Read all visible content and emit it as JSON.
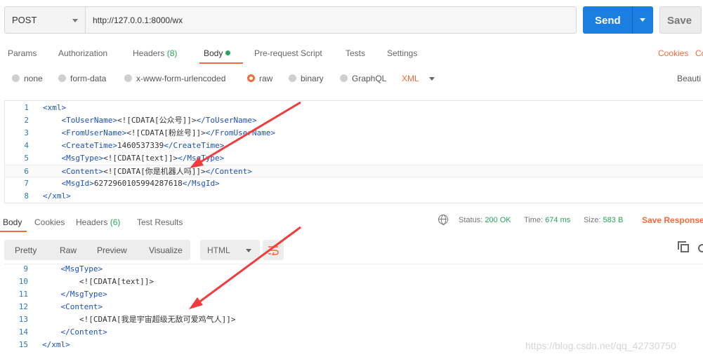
{
  "request": {
    "method": "POST",
    "url": "http://127.0.0.1:8000/wx",
    "send_label": "Send",
    "save_label": "Save"
  },
  "request_tabs": {
    "params": "Params",
    "authorization": "Authorization",
    "headers": "Headers",
    "headers_count": "(8)",
    "body": "Body",
    "prerequest": "Pre-request Script",
    "tests": "Tests",
    "settings": "Settings",
    "cookies": "Cookies",
    "code": "Co"
  },
  "body_types": {
    "none": "none",
    "form_data": "form-data",
    "urlencoded": "x-www-form-urlencoded",
    "raw": "raw",
    "binary": "binary",
    "graphql": "GraphQL",
    "format": "XML",
    "beautify": "Beauti"
  },
  "request_body": [
    {
      "n": "1",
      "indent": "",
      "pre": "<xml>",
      "text": "",
      "post": ""
    },
    {
      "n": "2",
      "indent": "    ",
      "pre": "<ToUserName>",
      "text": "<![CDATA[公众号]]>",
      "post": "</ToUserName>"
    },
    {
      "n": "3",
      "indent": "    ",
      "pre": "<FromUserName>",
      "text": "<![CDATA[粉丝号]]>",
      "post": "</FromUserName>"
    },
    {
      "n": "4",
      "indent": "    ",
      "pre": "<CreateTime>",
      "text": "1460537339",
      "post": "</CreateTime>"
    },
    {
      "n": "5",
      "indent": "    ",
      "pre": "<MsgType>",
      "text": "<![CDATA[text]]>",
      "post": "</MsgType>"
    },
    {
      "n": "6",
      "indent": "    ",
      "pre": "<Content>",
      "text": "<![CDATA[你是机器人吗]]>",
      "post": "</Content>"
    },
    {
      "n": "7",
      "indent": "    ",
      "pre": "<MsgId>",
      "text": "6272960105994287618",
      "post": "</MsgId>"
    },
    {
      "n": "8",
      "indent": "",
      "pre": "</xml>",
      "text": "",
      "post": ""
    }
  ],
  "response_tabs": {
    "body": "Body",
    "cookies": "Cookies",
    "headers": "Headers",
    "headers_count": "(6)",
    "test_results": "Test Results"
  },
  "response_status": {
    "status_label": "Status:",
    "status_value": "200 OK",
    "time_label": "Time:",
    "time_value": "674 ms",
    "size_label": "Size:",
    "size_value": "583 B",
    "save_response": "Save Response"
  },
  "response_view": {
    "pretty": "Pretty",
    "raw": "Raw",
    "preview": "Preview",
    "visualize": "Visualize",
    "format": "HTML"
  },
  "response_body": [
    {
      "n": "9",
      "indent": "    ",
      "pre": "<MsgType>",
      "text": "",
      "post": ""
    },
    {
      "n": "10",
      "indent": "        ",
      "pre": "",
      "text": "<![CDATA[text]]>",
      "post": ""
    },
    {
      "n": "11",
      "indent": "    ",
      "pre": "</MsgType>",
      "text": "",
      "post": ""
    },
    {
      "n": "12",
      "indent": "    ",
      "pre": "<Content>",
      "text": "",
      "post": ""
    },
    {
      "n": "13",
      "indent": "        ",
      "pre": "",
      "text": "<![CDATA[我是宇宙超级无敌可爱鸡气人]]>",
      "post": ""
    },
    {
      "n": "14",
      "indent": "    ",
      "pre": "</Content>",
      "text": "",
      "post": ""
    },
    {
      "n": "15",
      "indent": "",
      "pre": "</xml>",
      "text": "",
      "post": ""
    }
  ],
  "watermark": "https://blog.csdn.net/qq_42730750",
  "colors": {
    "accent": "#f26b3a",
    "send": "#1a7fe0",
    "success": "#26a65b",
    "annotation_arrow": "#f03c3c"
  },
  "icons": [
    "dropdown-caret-icon",
    "globe-icon",
    "wrap-lines-icon",
    "copy-icon",
    "search-icon",
    "annotation-arrow-icon"
  ]
}
